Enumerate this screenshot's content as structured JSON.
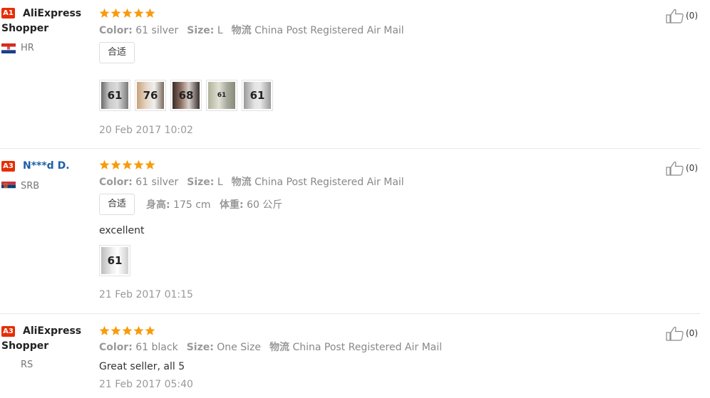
{
  "star_color": "#f89b0b",
  "badge_color": "#e62e04",
  "reviews": [
    {
      "badge": "A1",
      "name": "AliExpress Shopper",
      "country": "HR",
      "stars": 5,
      "color_label": "Color:",
      "color_value": "61 silver",
      "size_label": "Size:",
      "size_value": "L",
      "logistics_label": "物流",
      "logistics_value": "China Post Registered Air Mail",
      "tag": "合适",
      "photos": [
        "61",
        "76",
        "68",
        "61",
        "61"
      ],
      "date": "20 Feb 2017 10:02",
      "likes": "(0)"
    },
    {
      "badge": "A3",
      "name": "N***d D.",
      "country": "SRB",
      "stars": 5,
      "color_label": "Color:",
      "color_value": "61 silver",
      "size_label": "Size:",
      "size_value": "L",
      "logistics_label": "物流",
      "logistics_value": "China Post Registered Air Mail",
      "tag": "合适",
      "height_label": "身高:",
      "height_value": "175 cm",
      "weight_label": "体重:",
      "weight_value": "60 公斤",
      "text": "excellent",
      "photos": [
        "61"
      ],
      "date": "21 Feb 2017 01:15",
      "likes": "(0)"
    },
    {
      "badge": "A3",
      "name": "AliExpress Shopper",
      "country": "RS",
      "stars": 5,
      "color_label": "Color:",
      "color_value": "61 black",
      "size_label": "Size:",
      "size_value": "One Size",
      "logistics_label": "物流",
      "logistics_value": "China Post Registered Air Mail",
      "text": "Great seller, all 5",
      "date": "21 Feb 2017 05:40",
      "likes": "(0)"
    }
  ]
}
